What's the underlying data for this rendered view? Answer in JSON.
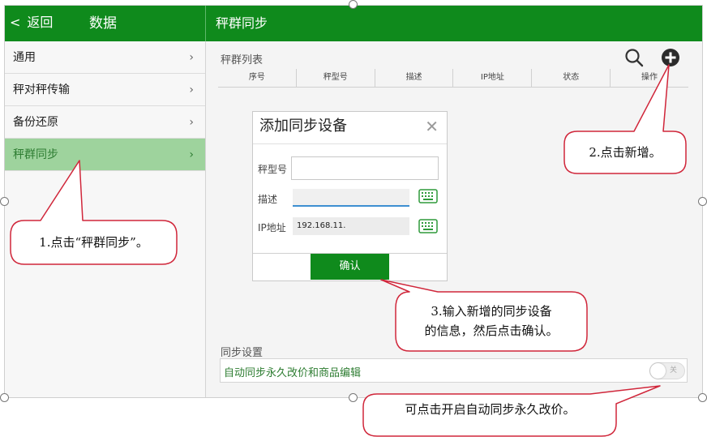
{
  "header": {
    "back_label": "返回",
    "left_title": "数据",
    "right_title": "秤群同步"
  },
  "sidebar": {
    "items": [
      {
        "label": "通用"
      },
      {
        "label": "秤对秤传输"
      },
      {
        "label": "备份还原"
      },
      {
        "label": "秤群同步",
        "active": true
      }
    ],
    "arrow_glyph": "›"
  },
  "list_section": {
    "title": "秤群列表",
    "columns": [
      "序号",
      "秤型号",
      "描述",
      "IP地址",
      "状态",
      "操作"
    ],
    "icons": [
      "search-icon",
      "add-icon"
    ]
  },
  "dialog": {
    "title": "添加同步设备",
    "close_glyph": "✕",
    "model_label": "秤型号",
    "model_value": "",
    "desc_label": "描述",
    "desc_value": "",
    "ip_label": "IP地址",
    "ip_value": "192.168.11.",
    "confirm_label": "确认"
  },
  "sync_settings": {
    "title": "同步设置",
    "auto_sync_label": "自动同步永久改价和商品编辑",
    "toggle_state": "关"
  },
  "callouts": {
    "c1": "1.点击“秤群同步”。",
    "c2": "2.点击新增。",
    "c3_line1": "3.输入新增的同步设备",
    "c3_line2": "的信息，然后点击确认。",
    "c4": "可点击开启自动同步永久改价。"
  },
  "colors": {
    "header_green": "#0f8a1c",
    "active_item_bg": "#9ed39d",
    "callout_border": "#d0263a"
  }
}
